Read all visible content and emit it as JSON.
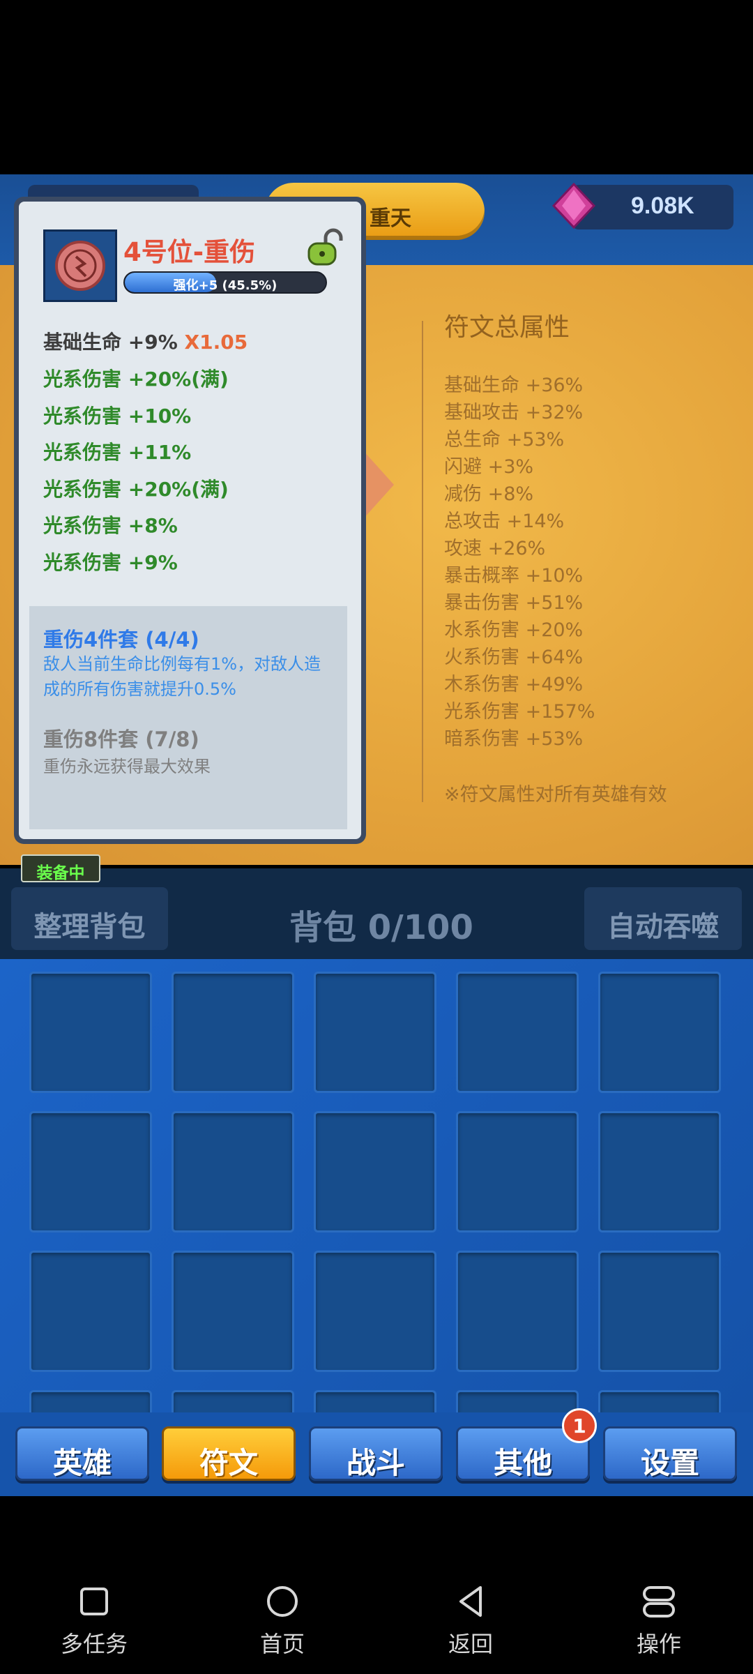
{
  "top_bar": {
    "stage_label": "重天",
    "gem_value": "9.08K"
  },
  "rune_totals": {
    "title": "符文总属性",
    "items": [
      "基础生命 +36%",
      "基础攻击 +32%",
      "总生命 +53%",
      "闪避 +3%",
      "减伤 +8%",
      "总攻击 +14%",
      "攻速 +26%",
      "暴击概率 +10%",
      "暴击伤害 +51%",
      "水系伤害 +20%",
      "火系伤害 +64%",
      "木系伤害 +49%",
      "光系伤害 +157%",
      "暗系伤害 +53%"
    ],
    "note": "※符文属性对所有英雄有效"
  },
  "rune_card": {
    "title": "4号位-重伤",
    "enhance_label": "强化+5 (45.5%)",
    "enhance_progress": 0.455,
    "base_stat": "基础生命 +9%",
    "base_multiplier": "X1.05",
    "sub_stats": [
      "光系伤害 +20%(满)",
      "光系伤害 +10%",
      "光系伤害 +11%",
      "光系伤害 +20%(满)",
      "光系伤害 +8%",
      "光系伤害 +9%"
    ],
    "set_bonus_1": {
      "title": "重伤4件套 (4/4)",
      "description": "敌人当前生命比例每有1%，对敌人造成的所有伤害就提升0.5%"
    },
    "set_bonus_2": {
      "title": "重伤8件套 (7/8)",
      "description": "重伤永远获得最大效果"
    }
  },
  "equipped_tag": "装备中",
  "backpack": {
    "tidy_label": "整理背包",
    "count_label": "背包 0/100",
    "auto_devour_label": "自动吞噬"
  },
  "tabs": [
    {
      "label": "英雄"
    },
    {
      "label": "符文"
    },
    {
      "label": "战斗"
    },
    {
      "label": "其他"
    },
    {
      "label": "设置"
    }
  ],
  "tab_badge": "1",
  "active_tab": "符文",
  "android_nav": [
    {
      "label": "多任务",
      "icon": "square-icon"
    },
    {
      "label": "首页",
      "icon": "circle-icon"
    },
    {
      "label": "返回",
      "icon": "back-triangle-icon"
    },
    {
      "label": "操作",
      "icon": "toggle-icon"
    }
  ],
  "colors": {
    "accent_orange": "#f59a0a",
    "tab_blue": "#2d68c8",
    "title_red": "#e4513a",
    "stat_green": "#2f8a2a",
    "set_blue": "#2f7ae8",
    "equipped_green": "#6aff4c"
  }
}
